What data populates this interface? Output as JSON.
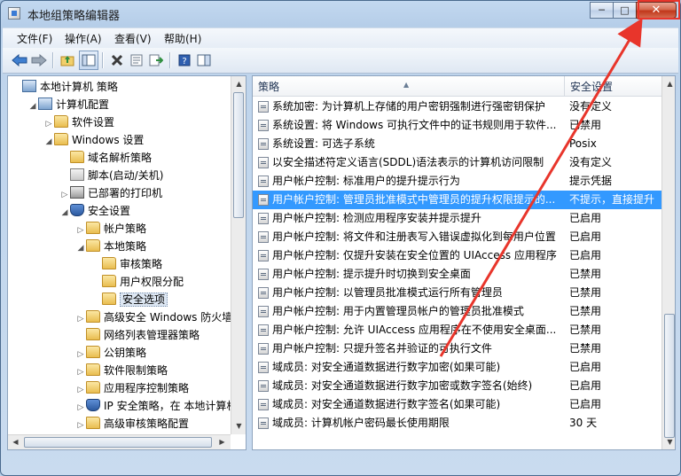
{
  "window": {
    "title": "本地组策略编辑器",
    "minimize": "─",
    "maximize": "□",
    "close": "✕"
  },
  "menu": [
    "文件(F)",
    "操作(A)",
    "查看(V)",
    "帮助(H)"
  ],
  "toolbar_icons": [
    "back-arrow-icon",
    "forward-arrow-icon",
    "up-folder-icon",
    "show-hide-tree-icon",
    "delete-icon",
    "properties-icon",
    "export-list-icon",
    "help-icon",
    "show-pane-icon"
  ],
  "tree": [
    {
      "label": "本地计算机 策略",
      "depth": 0,
      "icon": "computer",
      "expander": ""
    },
    {
      "label": "计算机配置",
      "depth": 1,
      "icon": "computer",
      "expander": "◢"
    },
    {
      "label": "软件设置",
      "depth": 2,
      "icon": "folder",
      "expander": "▷"
    },
    {
      "label": "Windows 设置",
      "depth": 2,
      "icon": "folder",
      "expander": "◢"
    },
    {
      "label": "域名解析策略",
      "depth": 3,
      "icon": "folder",
      "expander": ""
    },
    {
      "label": "脚本(启动/关机)",
      "depth": 3,
      "icon": "script",
      "expander": ""
    },
    {
      "label": "已部署的打印机",
      "depth": 3,
      "icon": "printer",
      "expander": "▷"
    },
    {
      "label": "安全设置",
      "depth": 3,
      "icon": "shield",
      "expander": "◢"
    },
    {
      "label": "帐户策略",
      "depth": 4,
      "icon": "folder",
      "expander": "▷"
    },
    {
      "label": "本地策略",
      "depth": 4,
      "icon": "folder",
      "expander": "◢"
    },
    {
      "label": "审核策略",
      "depth": 5,
      "icon": "folder",
      "expander": ""
    },
    {
      "label": "用户权限分配",
      "depth": 5,
      "icon": "folder",
      "expander": ""
    },
    {
      "label": "安全选项",
      "depth": 5,
      "icon": "folder",
      "expander": "",
      "selected": true
    },
    {
      "label": "高级安全 Windows 防火墙",
      "depth": 4,
      "icon": "folder",
      "expander": "▷"
    },
    {
      "label": "网络列表管理器策略",
      "depth": 4,
      "icon": "folder",
      "expander": ""
    },
    {
      "label": "公钥策略",
      "depth": 4,
      "icon": "folder",
      "expander": "▷"
    },
    {
      "label": "软件限制策略",
      "depth": 4,
      "icon": "folder",
      "expander": "▷"
    },
    {
      "label": "应用程序控制策略",
      "depth": 4,
      "icon": "folder",
      "expander": "▷"
    },
    {
      "label": "IP 安全策略，在 本地计算机",
      "depth": 4,
      "icon": "shield",
      "expander": "▷"
    },
    {
      "label": "高级审核策略配置",
      "depth": 4,
      "icon": "folder",
      "expander": "▷"
    }
  ],
  "list": {
    "col_policy": "策略",
    "col_setting": "安全设置",
    "sort_caret": "▲",
    "rows": [
      {
        "name": "系统加密: 为计算机上存储的用户密钥强制进行强密钥保护",
        "value": "没有定义"
      },
      {
        "name": "系统设置: 将 Windows 可执行文件中的证书规则用于软件...",
        "value": "已禁用"
      },
      {
        "name": "系统设置: 可选子系统",
        "value": "Posix"
      },
      {
        "name": "以安全描述符定义语言(SDDL)语法表示的计算机访问限制",
        "value": "没有定义"
      },
      {
        "name": "用户帐户控制: 标准用户的提升提示行为",
        "value": "提示凭据"
      },
      {
        "name": "用户帐户控制: 管理员批准模式中管理员的提升权限提示的...",
        "value": "不提示，直接提升",
        "selected": true
      },
      {
        "name": "用户帐户控制: 检测应用程序安装并提示提升",
        "value": "已启用"
      },
      {
        "name": "用户帐户控制: 将文件和注册表写入错误虚拟化到每用户位置",
        "value": "已启用"
      },
      {
        "name": "用户帐户控制: 仅提升安装在安全位置的 UIAccess 应用程序",
        "value": "已启用"
      },
      {
        "name": "用户帐户控制: 提示提升时切换到安全桌面",
        "value": "已禁用"
      },
      {
        "name": "用户帐户控制: 以管理员批准模式运行所有管理员",
        "value": "已禁用"
      },
      {
        "name": "用户帐户控制: 用于内置管理员帐户的管理员批准模式",
        "value": "已禁用"
      },
      {
        "name": "用户帐户控制: 允许 UIAccess 应用程序在不使用安全桌面...",
        "value": "已禁用"
      },
      {
        "name": "用户帐户控制: 只提升签名并验证的可执行文件",
        "value": "已禁用"
      },
      {
        "name": "域成员: 对安全通道数据进行数字加密(如果可能)",
        "value": "已启用"
      },
      {
        "name": "域成员: 对安全通道数据进行数字加密或数字签名(始终)",
        "value": "已启用"
      },
      {
        "name": "域成员: 对安全通道数据进行数字签名(如果可能)",
        "value": "已启用"
      },
      {
        "name": "域成员: 计算机帐户密码最长使用期限",
        "value": "30 天"
      }
    ]
  },
  "scroll_glyphs": {
    "up": "▲",
    "down": "▼",
    "left": "◀",
    "right": "▶"
  },
  "colors": {
    "selection": "#3399ff",
    "annotation_arrow": "#e8352b"
  }
}
